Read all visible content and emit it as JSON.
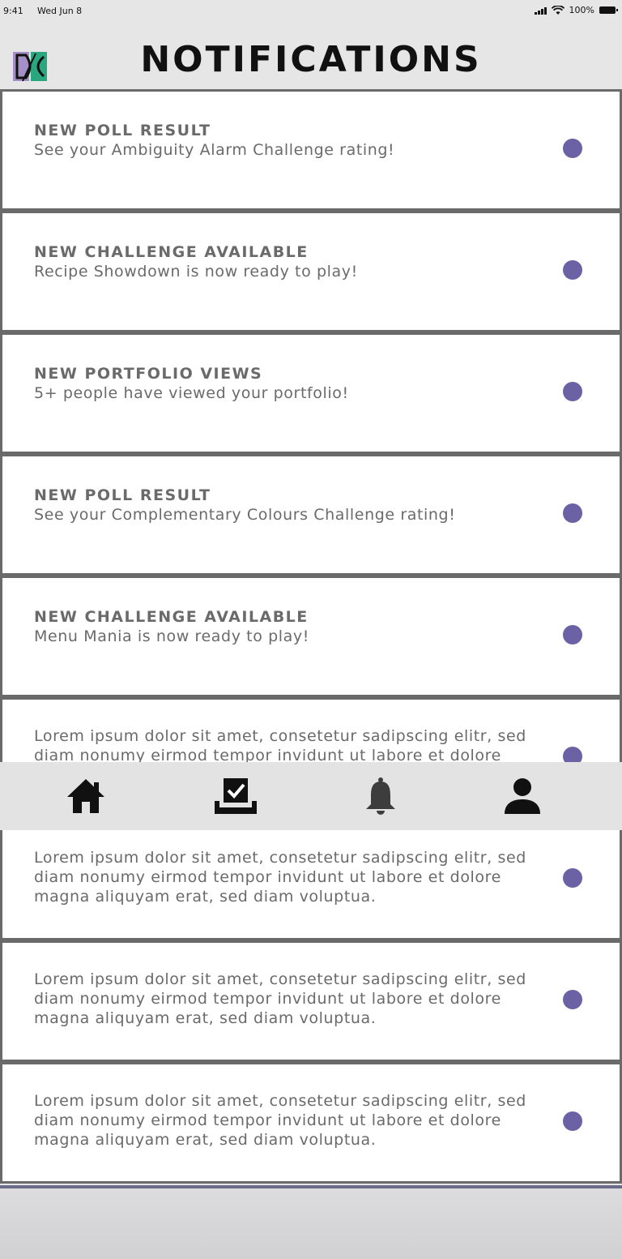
{
  "status_bar": {
    "time": "9:41",
    "date": "Wed Jun 8",
    "battery": "100%"
  },
  "header": {
    "title": "NOTIFICATIONS",
    "logo_icon": "app-logo-icon"
  },
  "colors": {
    "accent_dot": "#6a62a4",
    "card_border": "#6a6a6a",
    "text_gray": "#6a6a6a",
    "tabbar_bg": "#e3e3e3"
  },
  "notifications": [
    {
      "title": "NEW POLL RESULT",
      "body": "See your Ambiguity Alarm Challenge rating!"
    },
    {
      "title": "NEW CHALLENGE AVAILABLE",
      "body": "Recipe Showdown is now ready to play!"
    },
    {
      "title": "NEW PORTFOLIO VIEWS",
      "body": "5+ people have viewed your portfolio!"
    },
    {
      "title": "NEW POLL RESULT",
      "body": "See your Complementary Colours Challenge rating!"
    },
    {
      "title": "NEW CHALLENGE AVAILABLE",
      "body": "Menu Mania is now ready to play!"
    },
    {
      "title": "",
      "body": "Lorem ipsum dolor sit amet, consetetur sadipscing elitr, sed diam nonumy eirmod tempor invidunt ut labore et dolore magna aliquyam erat, sed diam voluptua."
    },
    {
      "title": "",
      "body": "Lorem ipsum dolor sit amet, consetetur sadipscing elitr, sed diam nonumy eirmod tempor invidunt ut labore et dolore magna aliquyam erat, sed diam voluptua."
    },
    {
      "title": "",
      "body": "Lorem ipsum dolor sit amet, consetetur sadipscing elitr, sed diam nonumy eirmod tempor invidunt ut labore et dolore magna aliquyam erat, sed diam voluptua."
    },
    {
      "title": "",
      "body": "Lorem ipsum dolor sit amet, consetetur sadipscing elitr, sed diam nonumy eirmod tempor invidunt ut labore et dolore magna aliquyam erat, sed diam voluptua."
    }
  ],
  "tabbar": {
    "items": [
      {
        "name": "home",
        "icon": "home-icon"
      },
      {
        "name": "challenges",
        "icon": "checkbox-tray-icon"
      },
      {
        "name": "notifications",
        "icon": "bell-icon"
      },
      {
        "name": "profile",
        "icon": "person-icon"
      }
    ]
  }
}
